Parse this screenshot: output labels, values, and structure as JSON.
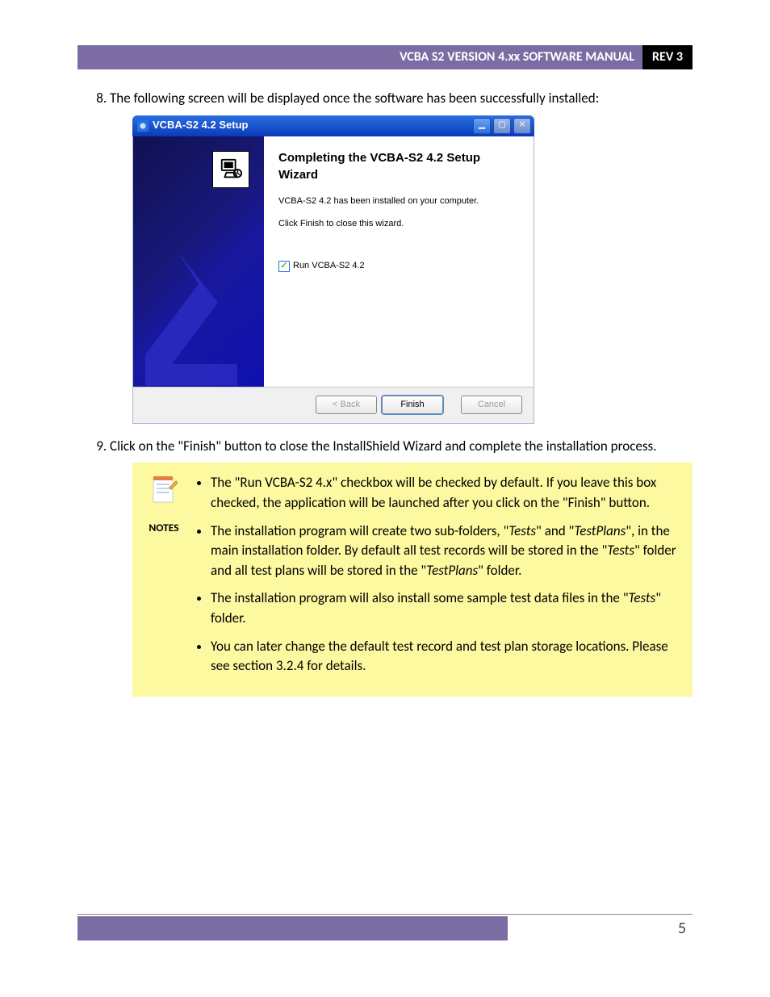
{
  "header": {
    "title": "VCBA S2 VERSION 4.xx SOFTWARE MANUAL",
    "rev": "REV 3"
  },
  "steps": {
    "n8": "8",
    "t8": "The following screen will be displayed once the software has been successfully installed:",
    "n9": "9",
    "t9": "Click on the \"Finish\" button to close the InstallShield Wizard and complete the installation process."
  },
  "wizard": {
    "title": "VCBA-S2 4.2 Setup",
    "heading": "Completing the VCBA-S2 4.2 Setup Wizard",
    "line1": "VCBA-S2 4.2 has been installed on your computer.",
    "line2": "Click Finish to close this wizard.",
    "checkbox_label": "Run VCBA-S2 4.2",
    "checkbox_checked": true,
    "buttons": {
      "back": "< Back",
      "finish": "Finish",
      "cancel": "Cancel"
    }
  },
  "notes": {
    "label": "NOTES",
    "items": [
      {
        "pre": "The \"Run VCBA-S2 4.x\" checkbox will be checked by default. If you leave this box checked, the application will be launched after you click on the \"Finish\" button."
      },
      {
        "pre": "The installation program will create two sub-folders, \"",
        "i1": "Tests",
        "mid1": "\" and \"",
        "i2": "TestPlans",
        "mid2": "\", in the main installation folder. By default all test records will be stored in the \"",
        "i3": "Tests",
        "mid3": "\" folder and all test plans will be stored in the \"",
        "i4": "TestPlans",
        "post": "\" folder."
      },
      {
        "pre": "The installation program will also install some sample test data files in the \"",
        "i1": "Tests",
        "post": "\" folder."
      },
      {
        "pre": "You can later change the default test record and test plan storage locations. Please see section 3.2.4 for details."
      }
    ]
  },
  "footer": {
    "page": "5"
  }
}
